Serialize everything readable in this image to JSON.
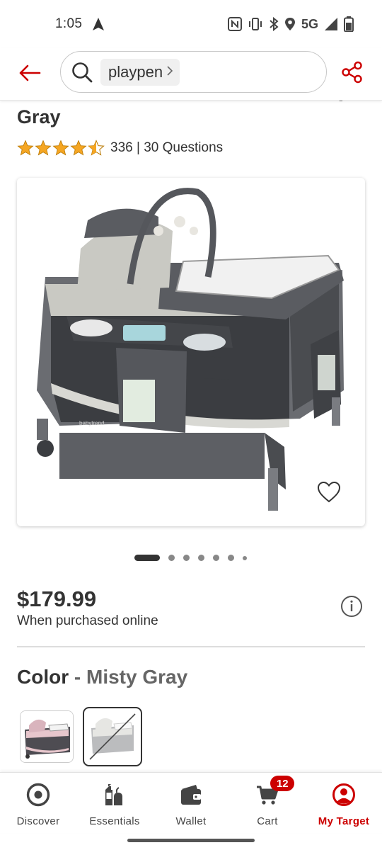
{
  "status_bar": {
    "time": "1:05",
    "network": "5G"
  },
  "header": {
    "search_query": "playpen",
    "icons": [
      "back-arrow-icon",
      "search-icon",
      "chevron-right-icon",
      "share-icon"
    ]
  },
  "product": {
    "title_line": "Gray",
    "rating": 4.5,
    "rating_text": "336 | 30 Questions",
    "image_count": 8,
    "active_image_index": 0,
    "price": "$179.99",
    "price_note": "When purchased online",
    "color_label": "Color",
    "color_separator": " - ",
    "color_value": "Misty Gray",
    "swatches": [
      {
        "name": "pink-gray",
        "selected": false,
        "available": true
      },
      {
        "name": "Misty Gray",
        "selected": true,
        "available": false
      }
    ]
  },
  "bottom_nav": {
    "items": [
      {
        "label": "Discover",
        "icon": "target-bullseye-icon",
        "active": false
      },
      {
        "label": "Essentials",
        "icon": "essentials-icon",
        "active": false
      },
      {
        "label": "Wallet",
        "icon": "wallet-icon",
        "active": false
      },
      {
        "label": "Cart",
        "icon": "cart-icon",
        "active": false,
        "badge": "12"
      },
      {
        "label": "My Target",
        "icon": "account-icon",
        "active": true
      }
    ]
  },
  "colors": {
    "brand_red": "#cc0000",
    "text_dark": "#333333",
    "star_gold": "#f5a623"
  }
}
